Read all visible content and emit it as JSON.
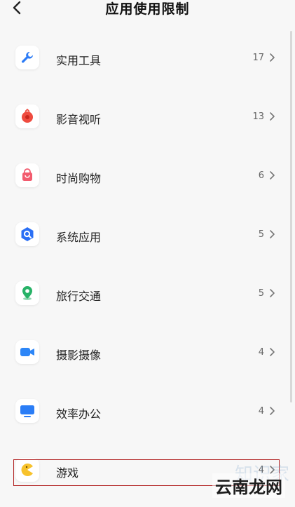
{
  "header": {
    "title": "应用使用限制"
  },
  "categories": [
    {
      "label": "实用工具",
      "count": "17",
      "icon": "wrench-icon",
      "color": "#2d7cf6"
    },
    {
      "label": "影音视听",
      "count": "13",
      "icon": "media-icon",
      "color": "#ef4b3f"
    },
    {
      "label": "时尚购物",
      "count": "6",
      "icon": "shopping-bag-icon",
      "color": "#f25b6e"
    },
    {
      "label": "系统应用",
      "count": "5",
      "icon": "system-search-icon",
      "color": "#2a6ff5"
    },
    {
      "label": "旅行交通",
      "count": "5",
      "icon": "map-pin-icon",
      "color": "#27b267"
    },
    {
      "label": "摄影摄像",
      "count": "4",
      "icon": "video-camera-icon",
      "color": "#2d86f7"
    },
    {
      "label": "效率办公",
      "count": "4",
      "icon": "monitor-icon",
      "color": "#2a7df6"
    },
    {
      "label": "游戏",
      "count": "4",
      "icon": "pacman-icon",
      "color": "#f7c22c"
    }
  ],
  "watermark": {
    "text": "云南龙网",
    "faint": "知识家"
  }
}
